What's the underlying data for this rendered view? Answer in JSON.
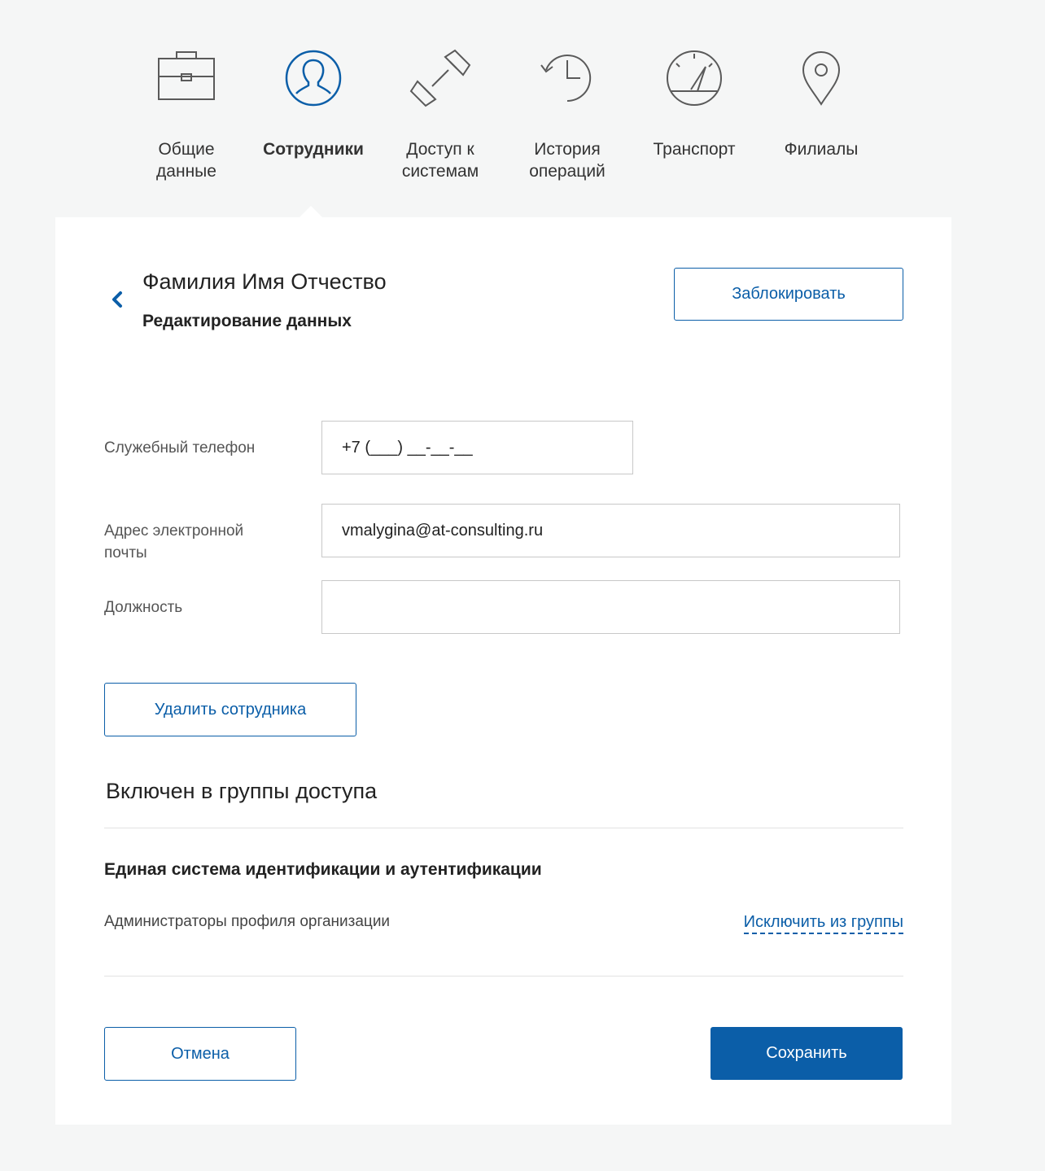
{
  "nav": {
    "items": [
      {
        "label": "Общие\nданные",
        "icon": "briefcase-icon"
      },
      {
        "label": "Сотрудники",
        "icon": "user-circle-icon",
        "active": true
      },
      {
        "label": "Доступ к\nсистемам",
        "icon": "link-icon"
      },
      {
        "label": "История\nопераций",
        "icon": "history-icon"
      },
      {
        "label": "Транспорт",
        "icon": "speedometer-icon"
      },
      {
        "label": "Филиалы",
        "icon": "map-pin-icon"
      }
    ]
  },
  "header": {
    "person_name": "Фамилия Имя Отчество",
    "subtitle": "Редактирование данных",
    "block_label": "Заблокировать"
  },
  "form": {
    "phone_label": "Служебный телефон",
    "phone_value": "+7 (___) __-__-__",
    "email_label": "Адрес электронной\nпочты",
    "email_value": "vmalygina@at-consulting.ru",
    "position_label": "Должность",
    "position_value": ""
  },
  "actions": {
    "delete_label": "Удалить сотрудника",
    "cancel_label": "Отмена",
    "save_label": "Сохранить"
  },
  "groups": {
    "title": "Включен в группы доступа",
    "items": [
      {
        "system": "Единая система идентификации и аутентификации",
        "role": "Администраторы профиля организации",
        "exclude_label": "Исключить из группы"
      }
    ]
  },
  "colors": {
    "accent": "#0b5ea8",
    "icon_stroke": "#5a5a5a",
    "active_icon": "#0b5ea8",
    "background": "#f5f6f6"
  }
}
